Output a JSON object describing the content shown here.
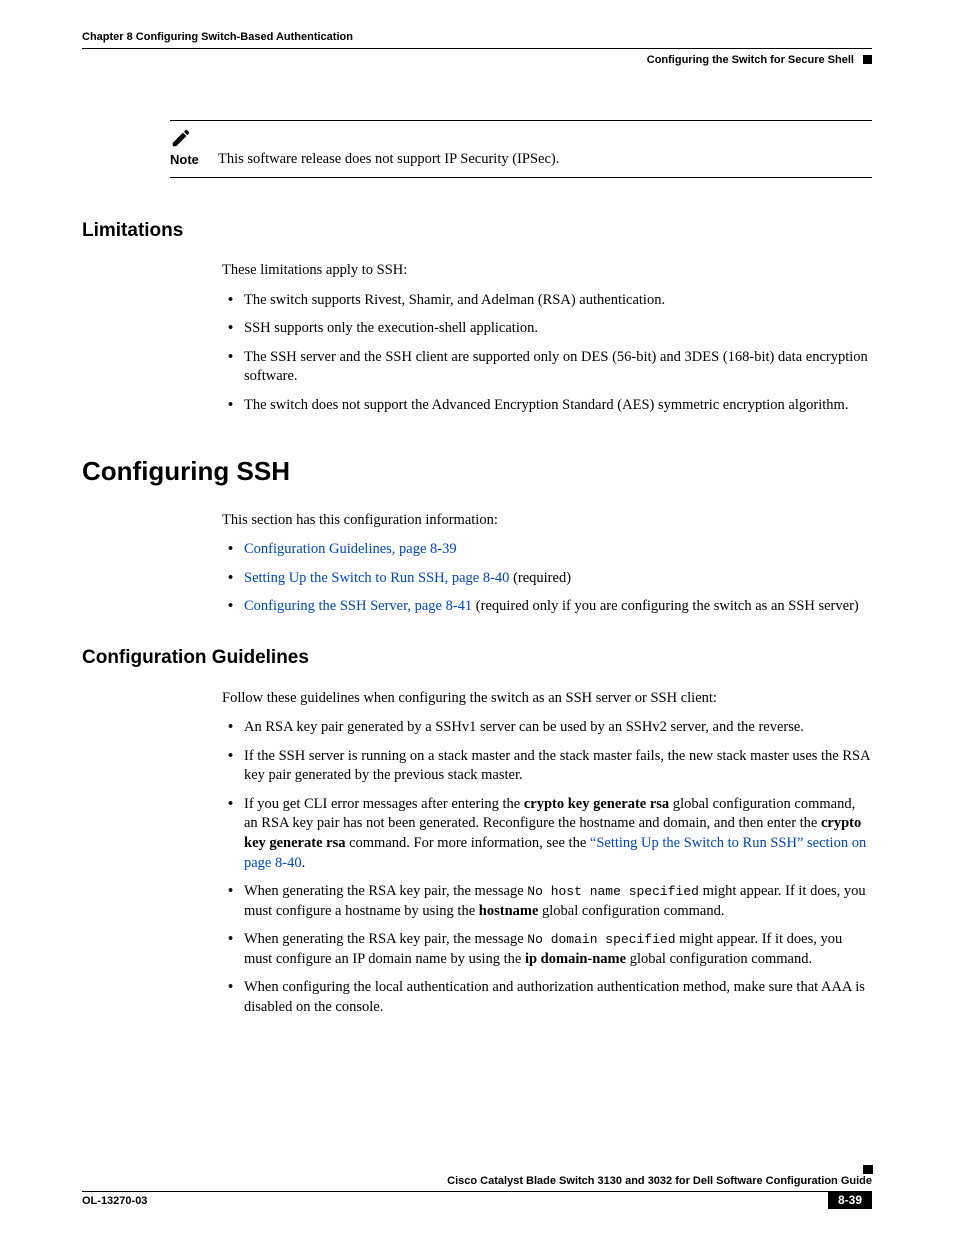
{
  "header": {
    "chapter": "Chapter 8      Configuring Switch-Based Authentication",
    "section": "Configuring the Switch for Secure Shell"
  },
  "note": {
    "label": "Note",
    "text": "This software release does not support IP Security (IPSec)."
  },
  "limitations": {
    "heading": "Limitations",
    "intro": "These limitations apply to SSH:",
    "items": [
      "The switch supports Rivest, Shamir, and Adelman (RSA) authentication.",
      "SSH supports only the execution-shell application.",
      "The SSH server and the SSH client are supported only on DES (56-bit) and 3DES (168-bit) data encryption software.",
      "The switch does not support the Advanced Encryption Standard (AES) symmetric encryption algorithm."
    ]
  },
  "configssh": {
    "heading": "Configuring SSH",
    "intro": "This section has this configuration information:",
    "links": {
      "l1": "Configuration Guidelines, page 8-39",
      "l2": "Setting Up the Switch to Run SSH, page 8-40",
      "l2_suffix": " (required)",
      "l3": "Configuring the SSH Server, page 8-41",
      "l3_suffix": " (required only if you are configuring the switch as an SSH server)"
    }
  },
  "guidelines": {
    "heading": "Configuration Guidelines",
    "intro": "Follow these guidelines when configuring the switch as an SSH server or SSH client:",
    "b1": "An RSA key pair generated by a SSHv1 server can be used by an SSHv2 server, and the reverse.",
    "b2": "If the SSH server is running on a stack master and the stack master fails, the new stack master uses the RSA key pair generated by the previous stack master.",
    "b3_a": "If you get CLI error messages after entering the ",
    "b3_cmd1": "crypto key generate rsa",
    "b3_b": " global configuration command, an RSA key pair has not been generated. Reconfigure the hostname and domain, and then enter the ",
    "b3_cmd2": "crypto key generate rsa",
    "b3_c": " command. For more information, see the ",
    "b3_link": "“Setting Up the Switch to Run SSH” section on page 8-40",
    "b3_d": ".",
    "b4_a": "When generating the RSA key pair, the message ",
    "b4_code": "No host name specified",
    "b4_b": " might appear. If it does, you must configure a hostname by using the ",
    "b4_cmd": "hostname",
    "b4_c": " global configuration command.",
    "b5_a": "When generating the RSA key pair, the message ",
    "b5_code": "No domain specified",
    "b5_b": " might appear. If it does, you must configure an IP domain name by using the ",
    "b5_cmd": "ip domain-name",
    "b5_c": " global configuration command.",
    "b6": "When configuring the local authentication and authorization authentication method, make sure that AAA is disabled on the console."
  },
  "footer": {
    "title": "Cisco Catalyst Blade Switch 3130 and 3032 for Dell Software Configuration Guide",
    "docid": "OL-13270-03",
    "page": "8-39"
  }
}
